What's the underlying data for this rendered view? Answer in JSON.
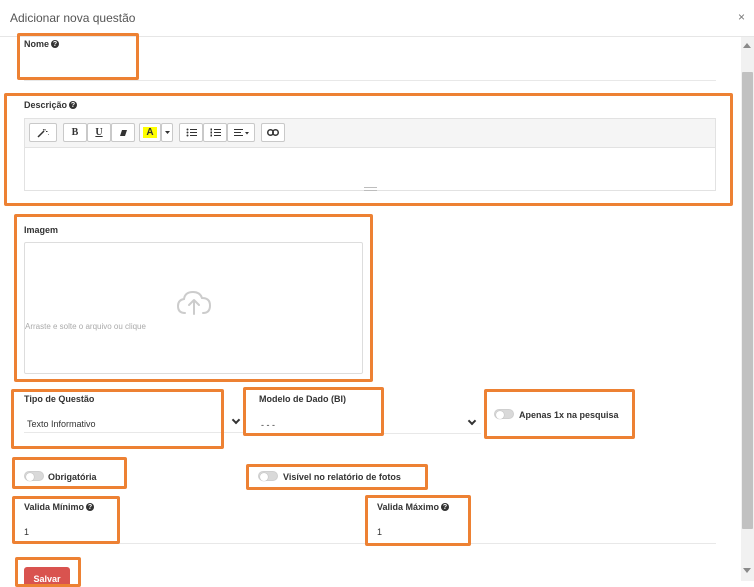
{
  "modal": {
    "title": "Adicionar nova questão",
    "close_label": "×"
  },
  "fields": {
    "nome": {
      "label": "Nome",
      "value": ""
    },
    "descricao": {
      "label": "Descrição"
    },
    "imagem": {
      "label": "Imagem",
      "dropzone_text": "Arraste e solte o arquivo ou clique"
    },
    "tipo_questao": {
      "label": "Tipo de Questão",
      "value": "Texto Informativo"
    },
    "modelo_dado": {
      "label": "Modelo de Dado (BI)",
      "value": "- - -"
    },
    "apenas_1x": {
      "label": "Apenas 1x na pesquisa",
      "checked": false
    },
    "obrigatoria": {
      "label": "Obrigatória",
      "checked": false
    },
    "visivel_relatorio": {
      "label": "Visível no relatório de fotos",
      "checked": false
    },
    "valida_minimo": {
      "label": "Valida Mínimo",
      "value": "1"
    },
    "valida_maximo": {
      "label": "Valida Máximo",
      "value": "1"
    }
  },
  "editor_toolbar": {
    "bold": "B",
    "underline": "U",
    "highlight": "A"
  },
  "actions": {
    "save_label": "Salvar"
  },
  "colors": {
    "highlight_box": "#ED8133",
    "save_button": "#d9534f",
    "highlight_swatch": "#FFFF00"
  }
}
